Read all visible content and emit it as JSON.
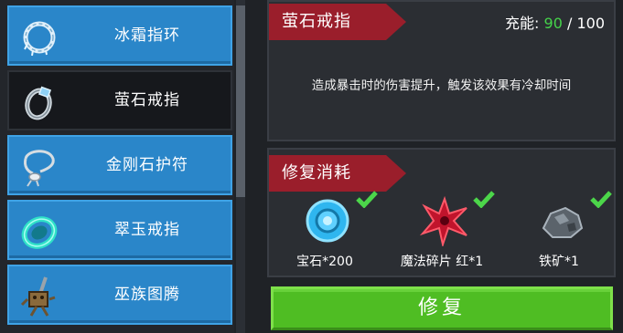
{
  "items": [
    {
      "name": "冰霜指环",
      "icon": "frost-ring-icon",
      "selected": false
    },
    {
      "name": "萤石戒指",
      "icon": "fluorite-ring-icon",
      "selected": true
    },
    {
      "name": "金刚石护符",
      "icon": "diamond-amulet-icon",
      "selected": false
    },
    {
      "name": "翠玉戒指",
      "icon": "jade-ring-icon",
      "selected": false
    },
    {
      "name": "巫族图腾",
      "icon": "witch-totem-icon",
      "selected": false
    }
  ],
  "detail": {
    "title": "萤石戒指",
    "energy_label": "充能:",
    "energy_current": "90",
    "energy_sep": "/",
    "energy_max": "100",
    "description": "造成暴击时的伤害提升，触发该效果有冷却时间"
  },
  "repair": {
    "title": "修复消耗",
    "materials": [
      {
        "label": "宝石*200",
        "icon": "gem-icon",
        "check": "checkmark-icon"
      },
      {
        "label": "魔法碎片 红*1",
        "icon": "red-magic-shard-icon",
        "check": "checkmark-icon"
      },
      {
        "label": "铁矿*1",
        "icon": "iron-ore-icon",
        "check": "checkmark-icon"
      }
    ],
    "button_label": "修复"
  },
  "colors": {
    "accent_blue": "#2a86c9",
    "ribbon_red": "#9a1e2b",
    "energy_green": "#45d24a",
    "button_green": "#4fbd23"
  }
}
